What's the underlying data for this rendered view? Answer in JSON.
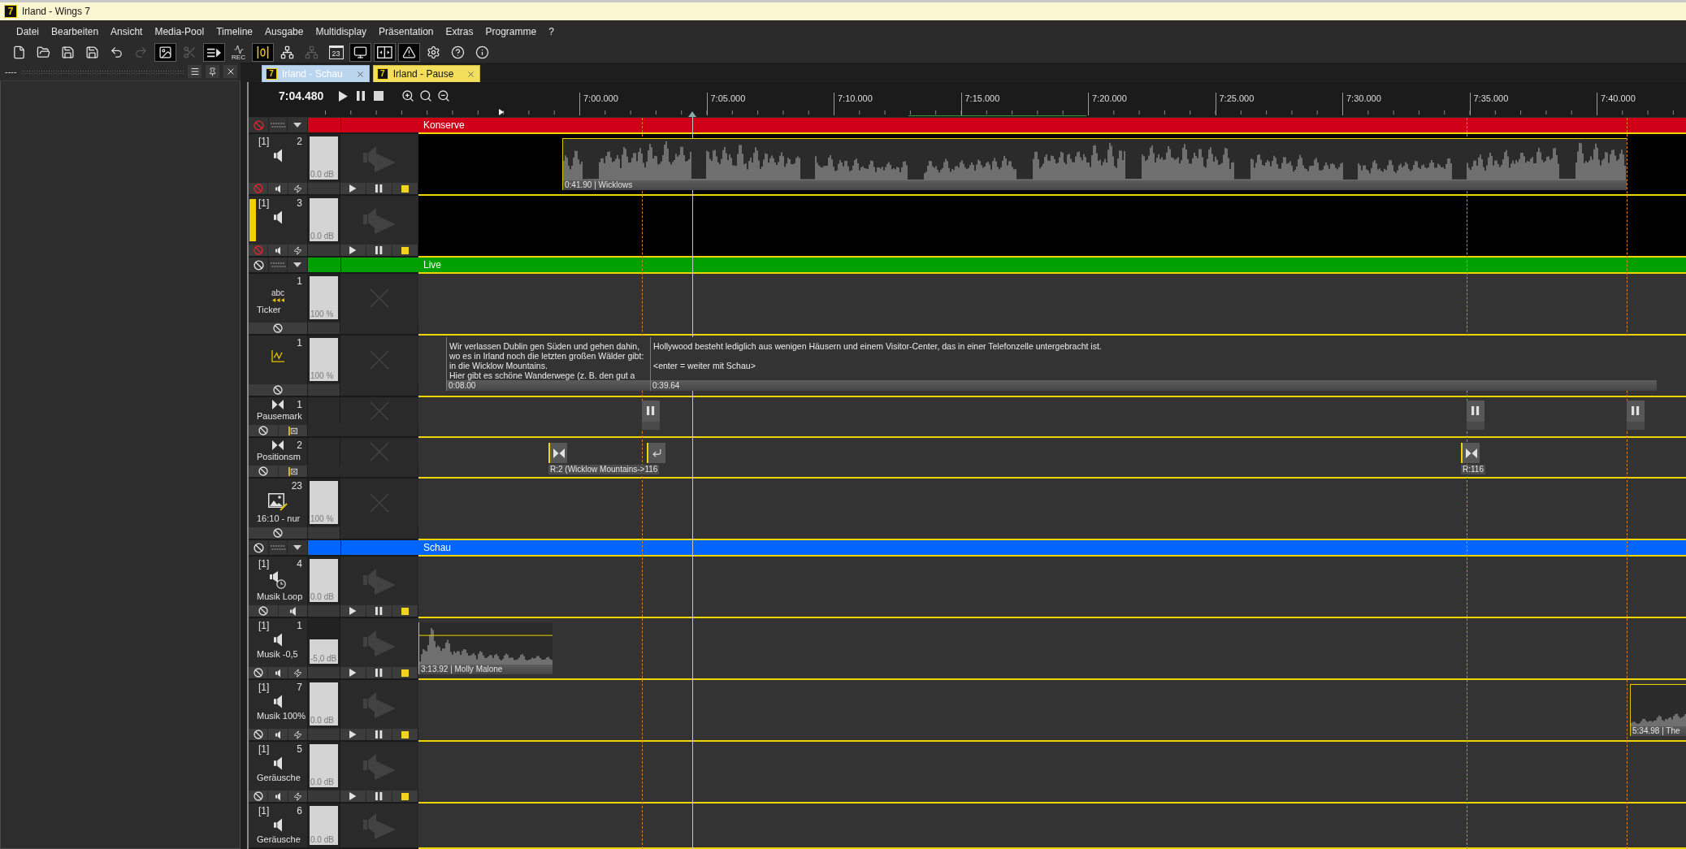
{
  "window": {
    "logo": "7",
    "title": "Irland - Wings 7"
  },
  "menu": [
    "Datei",
    "Bearbeiten",
    "Ansicht",
    "Media-Pool",
    "Timeline",
    "Ausgabe",
    "Multidisplay",
    "Präsentation",
    "Extras",
    "Programme",
    "?"
  ],
  "toolbar": [
    {
      "kind": "new",
      "active": false,
      "disabled": false
    },
    {
      "kind": "open",
      "active": false,
      "disabled": false
    },
    {
      "kind": "save",
      "active": false,
      "disabled": false
    },
    {
      "kind": "save_as",
      "active": false,
      "disabled": false
    },
    {
      "kind": "undo",
      "active": false,
      "disabled": false
    },
    {
      "kind": "redo",
      "active": false,
      "disabled": true
    },
    {
      "kind": "media",
      "active": true,
      "disabled": false
    },
    {
      "kind": "cut",
      "active": false,
      "disabled": true
    },
    {
      "kind": "playlist",
      "active": true,
      "disabled": false
    },
    {
      "kind": "record",
      "label": "REC",
      "active": false,
      "disabled": false
    },
    {
      "kind": "sync",
      "active": true,
      "disabled": false
    },
    {
      "kind": "hierarchy",
      "active": false,
      "disabled": false
    },
    {
      "kind": "hierarchy",
      "active": false,
      "disabled": true
    },
    {
      "kind": "calendar",
      "label": "23",
      "active": false,
      "disabled": false
    },
    {
      "kind": "monitor",
      "active": true,
      "disabled": false
    },
    {
      "kind": "split",
      "active": true,
      "disabled": false
    },
    {
      "kind": "warning",
      "active": true,
      "disabled": false
    },
    {
      "kind": "settings",
      "active": false,
      "disabled": false
    },
    {
      "kind": "help",
      "active": false,
      "disabled": false
    },
    {
      "kind": "info",
      "active": false,
      "disabled": false
    }
  ],
  "side_panel": {
    "title": "----"
  },
  "tabs": [
    {
      "logo": "7",
      "label": "Irland - Schau",
      "selected": false
    },
    {
      "logo": "7",
      "label": "Irland - Pause",
      "selected": true
    }
  ],
  "timeline": {
    "time": "7:04.480",
    "ruler": [
      "7:00.000",
      "7:05.000",
      "7:10.000",
      "7:15.000",
      "7:20.000",
      "7:25.000",
      "7:30.000",
      "7:35.000",
      "7:40.000"
    ],
    "groups": [
      {
        "name": "Konserve",
        "color": "#d00018",
        "disabled": true,
        "tracks": [
          {
            "kind": "audio",
            "output": "[1]",
            "number": "2",
            "level": 1,
            "reading": "0.0 dB",
            "selected": false,
            "disabled": true,
            "controls": [
              {
                "kind": "disable"
              },
              {
                "kind": "speaker"
              },
              {
                "kind": "flash"
              },
              {
                "kind": "play"
              },
              {
                "kind": "pause"
              },
              {
                "kind": "stop"
              }
            ],
            "clips": [
              {
                "kind": "audio",
                "label": "0:41.90 | Wicklows"
              }
            ]
          },
          {
            "kind": "audio",
            "output": "[1]",
            "number": "3",
            "level": 1,
            "reading": "0.0 dB",
            "selected": true,
            "disabled": true,
            "controls": [
              {
                "kind": "disable"
              },
              {
                "kind": "speaker"
              },
              {
                "kind": "flash"
              },
              {
                "kind": "play"
              },
              {
                "kind": "pause"
              },
              {
                "kind": "stop"
              }
            ]
          }
        ]
      },
      {
        "name": "Live",
        "color": "#00a000",
        "disabled": false,
        "tracks": [
          {
            "kind": "ticker",
            "icon_label": "abc",
            "number": "1",
            "name": "Ticker",
            "level": 1,
            "reading": "100 %",
            "selected": false,
            "disabled": false,
            "controls": [
              {
                "kind": "disable"
              }
            ]
          },
          {
            "kind": "text",
            "number": "1",
            "level": 1,
            "reading": "100 %",
            "selected": false,
            "disabled": false,
            "controls": [
              {
                "kind": "disable"
              }
            ],
            "clips": [
              {
                "kind": "text",
                "paragraphs": [
                  [
                    "Wir verlassen Dublin gen Süden und gehen dahin,",
                    "wo es in Irland noch die letzten großen Wälder gibt:",
                    "in die Wicklow Mountains.",
                    "Hier gibt es schöne Wanderwege (z. B. den gut a"
                  ]
                ],
                "time": "0:08.00"
              },
              {
                "kind": "text",
                "paragraphs": [
                  [
                    "Hollywood besteht lediglich aus wenigen Häusern und einem Visitor-Center, das in einer Telefonzelle untergebracht ist."
                  ],
                  [
                    "<enter = weiter mit Schau>"
                  ]
                ],
                "time": "0:39.64"
              }
            ]
          },
          {
            "kind": "pausemark",
            "number": "1",
            "name": "Pausemark",
            "selected": false,
            "disabled": false,
            "controls": [
              {
                "kind": "disable"
              },
              {
                "kind": "flag"
              }
            ],
            "clips": [
              {
                "kind": "pause"
              },
              {
                "kind": "pause"
              },
              {
                "kind": "pause"
              }
            ]
          },
          {
            "kind": "positionmark",
            "number": "2",
            "name": "Positionsm",
            "selected": false,
            "disabled": false,
            "controls": [
              {
                "kind": "disable"
              },
              {
                "kind": "flag"
              }
            ],
            "clips": [
              {
                "kind": "position",
                "label": "R:2 (Wicklow Mountains->116"
              },
              {
                "kind": "return"
              },
              {
                "kind": "position",
                "label": "R:116"
              }
            ]
          },
          {
            "kind": "image",
            "number": "23",
            "name": "16:10 - nur",
            "level": 1,
            "reading": "100 %",
            "selected": false,
            "disabled": false,
            "controls": [
              {
                "kind": "disable"
              }
            ]
          }
        ]
      },
      {
        "name": "Schau",
        "color": "#0066ff",
        "disabled": false,
        "tracks": [
          {
            "kind": "audio-loop",
            "output": "[1]",
            "number": "4",
            "name": "Musik Loop",
            "level": 1,
            "reading": "0.0 dB",
            "selected": false,
            "disabled": false,
            "controls": [
              {
                "kind": "disable"
              },
              {
                "kind": "speaker"
              },
              {
                "kind": "play"
              },
              {
                "kind": "pause"
              },
              {
                "kind": "stop"
              }
            ]
          },
          {
            "kind": "audio",
            "output": "[1]",
            "number": "1",
            "name": "Musik -0,5",
            "level": 0.56,
            "reading": "-5,0 dB",
            "selected": false,
            "disabled": false,
            "controls": [
              {
                "kind": "disable"
              },
              {
                "kind": "speaker"
              },
              {
                "kind": "flash"
              },
              {
                "kind": "play"
              },
              {
                "kind": "pause"
              },
              {
                "kind": "stop"
              }
            ],
            "clips": [
              {
                "kind": "audio",
                "label": "3:13.92 | Molly Malone"
              }
            ]
          },
          {
            "kind": "audio",
            "output": "[1]",
            "number": "7",
            "name": "Musik 100%",
            "level": 1,
            "reading": "0.0 dB",
            "selected": false,
            "disabled": false,
            "controls": [
              {
                "kind": "disable"
              },
              {
                "kind": "speaker"
              },
              {
                "kind": "flash"
              },
              {
                "kind": "play"
              },
              {
                "kind": "pause"
              },
              {
                "kind": "stop"
              }
            ],
            "clips": [
              {
                "kind": "audio",
                "label": "5:34.98 | The"
              }
            ]
          },
          {
            "kind": "audio",
            "output": "[1]",
            "number": "5",
            "name": "Geräusche",
            "level": 1,
            "reading": "0.0 dB",
            "selected": false,
            "disabled": false,
            "controls": [
              {
                "kind": "disable"
              },
              {
                "kind": "speaker"
              },
              {
                "kind": "flash"
              },
              {
                "kind": "play"
              },
              {
                "kind": "pause"
              },
              {
                "kind": "stop"
              }
            ]
          },
          {
            "kind": "audio",
            "output": "[1]",
            "number": "6",
            "name": "Geräusche",
            "level": 1,
            "reading": "0.0 dB",
            "selected": false
          }
        ]
      }
    ]
  }
}
